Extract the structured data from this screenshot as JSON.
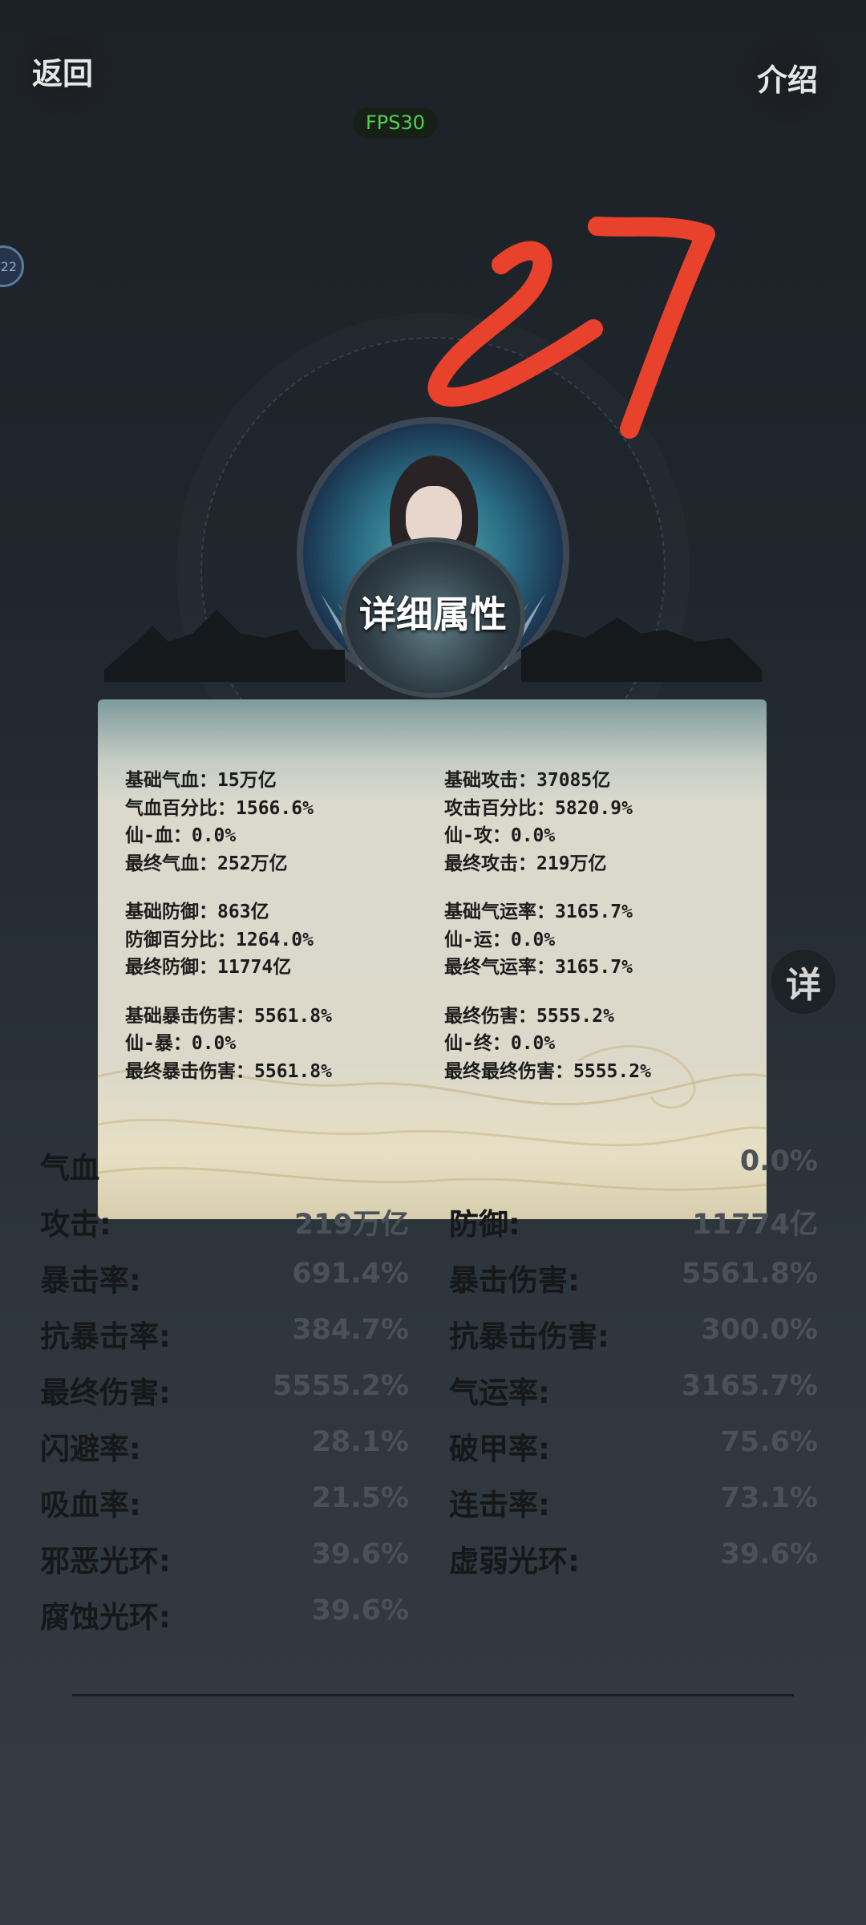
{
  "header": {
    "back_label": "返回",
    "intro_label": "介绍",
    "fps_label": "FPS30",
    "side_badge": "22"
  },
  "annotation": {
    "handwritten_number": "27",
    "color": "#e8412c"
  },
  "detail": {
    "title": "详细属性",
    "left": [
      [
        "基础气血：15万亿",
        "气血百分比：1566.6%",
        "仙-血：0.0%",
        "最终气血：252万亿"
      ],
      [
        "基础防御：863亿",
        "防御百分比：1264.0%",
        "最终防御：11774亿"
      ],
      [
        "基础暴击伤害：5561.8%",
        "仙-暴：0.0%",
        "最终暴击伤害：5561.8%"
      ]
    ],
    "right": [
      [
        "基础攻击：37085亿",
        "攻击百分比：5820.9%",
        "仙-攻：0.0%",
        "最终攻击：219万亿"
      ],
      [
        "基础气运率：3165.7%",
        "仙-运：0.0%",
        "最终气运率：3165.7%"
      ],
      [
        "最终伤害：5555.2%",
        "仙-终：0.0%",
        "最终最终伤害：5555.2%"
      ]
    ]
  },
  "detail_button": "详",
  "stats": [
    {
      "left_label": "气血",
      "left_value": "",
      "right_label": "",
      "right_value": "0.0%"
    },
    {
      "left_label": "攻击:",
      "left_value": "219万亿",
      "right_label": "防御:",
      "right_value": "11774亿"
    },
    {
      "left_label": "暴击率:",
      "left_value": "691.4%",
      "right_label": "暴击伤害:",
      "right_value": "5561.8%"
    },
    {
      "left_label": "抗暴击率:",
      "left_value": "384.7%",
      "right_label": "抗暴击伤害:",
      "right_value": "300.0%"
    },
    {
      "left_label": "最终伤害:",
      "left_value": "5555.2%",
      "right_label": "气运率:",
      "right_value": "3165.7%"
    },
    {
      "left_label": "闪避率:",
      "left_value": "28.1%",
      "right_label": "破甲率:",
      "right_value": "75.6%"
    },
    {
      "left_label": "吸血率:",
      "left_value": "21.5%",
      "right_label": "连击率:",
      "right_value": "73.1%"
    },
    {
      "left_label": "邪恶光环:",
      "left_value": "39.6%",
      "right_label": "虚弱光环:",
      "right_value": "39.6%"
    },
    {
      "left_label": "腐蚀光环:",
      "left_value": "39.6%",
      "right_label": "",
      "right_value": ""
    }
  ]
}
